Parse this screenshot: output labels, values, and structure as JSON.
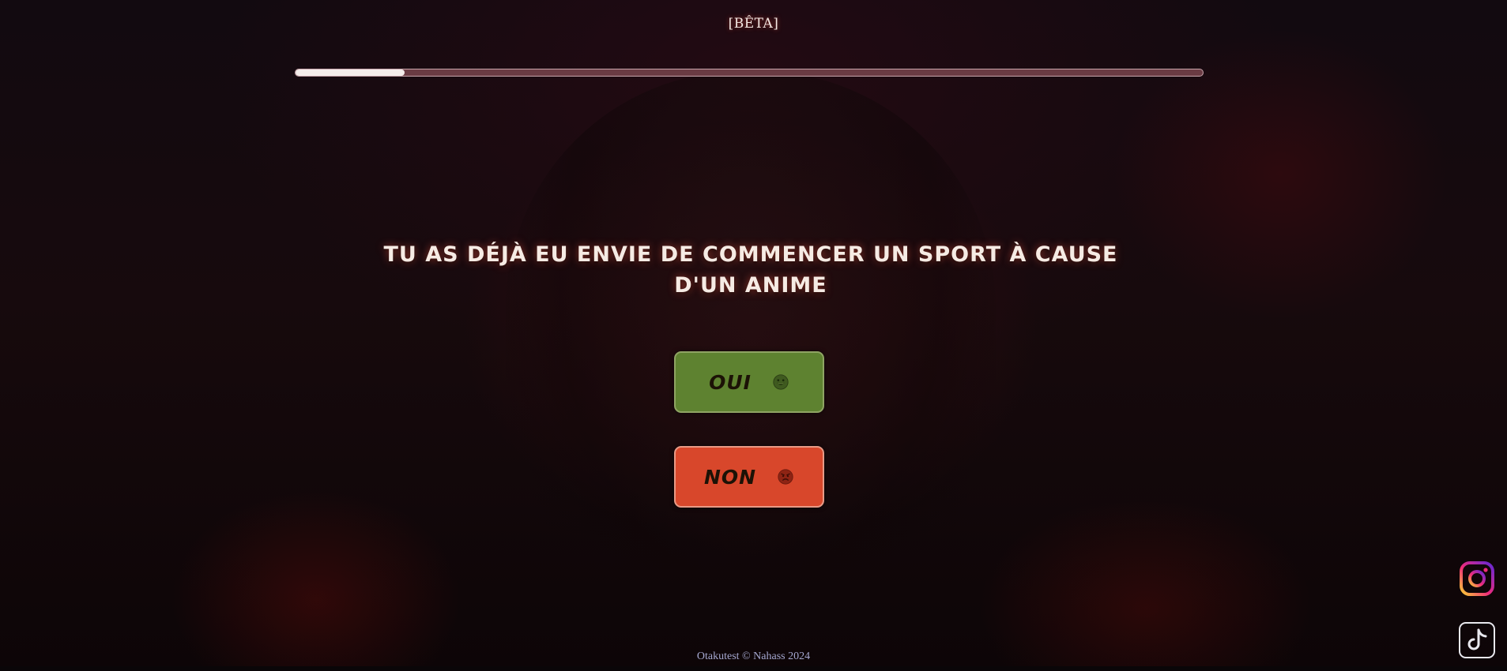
{
  "header": {
    "badge": "[BÊTA]"
  },
  "progress": {
    "fraction": 0.12
  },
  "question": {
    "text": "TU AS DÉJÀ EU ENVIE DE COMMENCER UN SPORT À CAUSE D'UN ANIME"
  },
  "answers": {
    "yes": {
      "label": "OUI",
      "icon": "grinning-face-icon",
      "color": "#5e8230"
    },
    "no": {
      "label": "NON",
      "icon": "angry-face-icon",
      "color": "#d8472b"
    }
  },
  "social": {
    "instagram_icon": "instagram-icon",
    "tiktok_icon": "tiktok-icon"
  },
  "footer": {
    "text": "Otakutest © Nahass 2024"
  }
}
